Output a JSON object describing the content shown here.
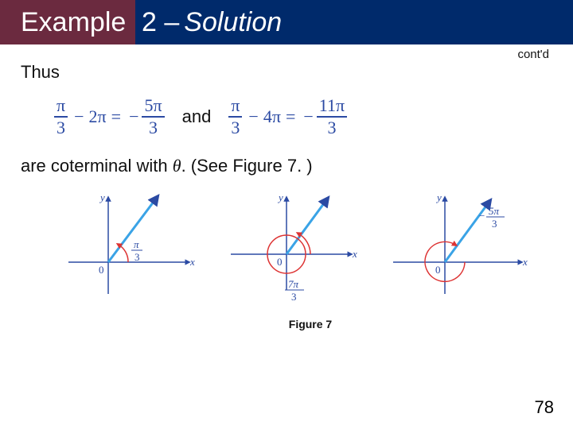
{
  "title": {
    "example_word": "Example",
    "number_dash": "2 –",
    "solution_word": "Solution"
  },
  "cont_label": "cont'd",
  "thus": "Thus",
  "and_word": "and",
  "eq1": {
    "n1": "π",
    "d1": "3",
    "minus": "−",
    "twopi": "2π",
    "equals": "=",
    "neg": "−",
    "n2": "5π",
    "d2": "3"
  },
  "eq2": {
    "n1": "π",
    "d1": "3",
    "minus": "−",
    "twopi": "4π",
    "equals": "=",
    "neg": "−",
    "n2": "11π",
    "d2": "3"
  },
  "coterm_prefix": "are coterminal with ",
  "theta": "θ",
  "coterm_suffix": ". (See Figure 7. )",
  "figure_caption": "Figure 7",
  "page_number": "78",
  "axes": {
    "x": "x",
    "y": "y",
    "origin": "0"
  },
  "plot_labels": {
    "a": {
      "num": "π",
      "den": "3"
    },
    "b": {
      "num": "7π",
      "den": "3"
    },
    "c": {
      "neg": "−",
      "num": "5π",
      "den": "3"
    }
  },
  "chart_data": [
    {
      "type": "angle-diagram",
      "terminal_angle_deg": 60,
      "label": "π/3",
      "rotation_shown": "π/3",
      "direction": "ccw"
    },
    {
      "type": "angle-diagram",
      "terminal_angle_deg": 60,
      "label": "7π/3",
      "rotation_shown": "7π/3",
      "direction": "ccw"
    },
    {
      "type": "angle-diagram",
      "terminal_angle_deg": 60,
      "label": "-5π/3",
      "rotation_shown": "-5π/3",
      "direction": "cw"
    }
  ]
}
